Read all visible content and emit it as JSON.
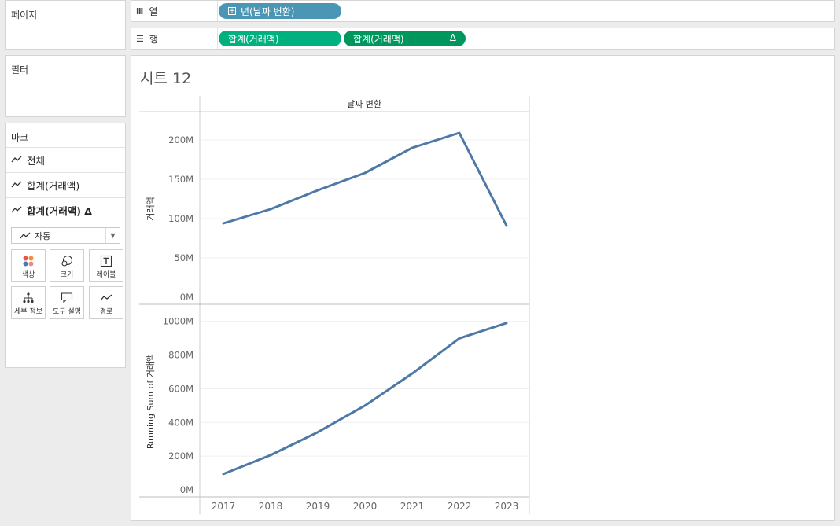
{
  "pages": {
    "title": "페이지"
  },
  "filters": {
    "title": "필터"
  },
  "marks": {
    "title": "마크",
    "rows": [
      {
        "label": "전체",
        "bold": false
      },
      {
        "label": "합계(거래액)",
        "bold": false
      },
      {
        "label": "합계(거래액) Δ",
        "bold": true
      }
    ],
    "mark_type": "자동",
    "buttons": [
      {
        "label": "색상",
        "icon": "color-dots-icon"
      },
      {
        "label": "크기",
        "icon": "size-circles-icon"
      },
      {
        "label": "레이블",
        "icon": "label-t-icon"
      },
      {
        "label": "세부 정보",
        "icon": "detail-hierarchy-icon"
      },
      {
        "label": "도구 설명",
        "icon": "tooltip-bubble-icon"
      },
      {
        "label": "경로",
        "icon": "path-line-icon"
      }
    ]
  },
  "shelves": {
    "columns": {
      "label": "열",
      "pills": [
        {
          "text": "년(날짜 변환)"
        }
      ]
    },
    "rows": {
      "label": "행",
      "pills": [
        {
          "text": "합계(거래액)"
        },
        {
          "text": "합계(거래액)",
          "delta": "Δ"
        }
      ]
    }
  },
  "sheet": {
    "title": "시트 12"
  },
  "chart_data": [
    {
      "type": "line",
      "header": "날짜 변환",
      "ylabel": "거래액",
      "x": [
        "2017",
        "2018",
        "2019",
        "2020",
        "2021",
        "2022",
        "2023"
      ],
      "values": [
        94,
        112,
        136,
        158,
        190,
        209,
        91
      ],
      "ylim": [
        0,
        225
      ],
      "yticks": [
        0,
        50,
        100,
        150,
        200
      ],
      "ytick_labels": [
        "0M",
        "50M",
        "100M",
        "150M",
        "200M"
      ],
      "color": "#4e79a7"
    },
    {
      "type": "line",
      "ylabel": "Running Sum of 거래액",
      "x": [
        "2017",
        "2018",
        "2019",
        "2020",
        "2021",
        "2022",
        "2023"
      ],
      "values": [
        94,
        206,
        342,
        500,
        690,
        899,
        990
      ],
      "ylim": [
        0,
        1050
      ],
      "yticks": [
        0,
        200,
        400,
        600,
        800,
        1000
      ],
      "ytick_labels": [
        "0M",
        "200M",
        "400M",
        "600M",
        "800M",
        "1000M"
      ],
      "color": "#4e79a7"
    }
  ],
  "x_axis": {
    "tick_labels": [
      "2017",
      "2018",
      "2019",
      "2020",
      "2021",
      "2022",
      "2023"
    ]
  }
}
